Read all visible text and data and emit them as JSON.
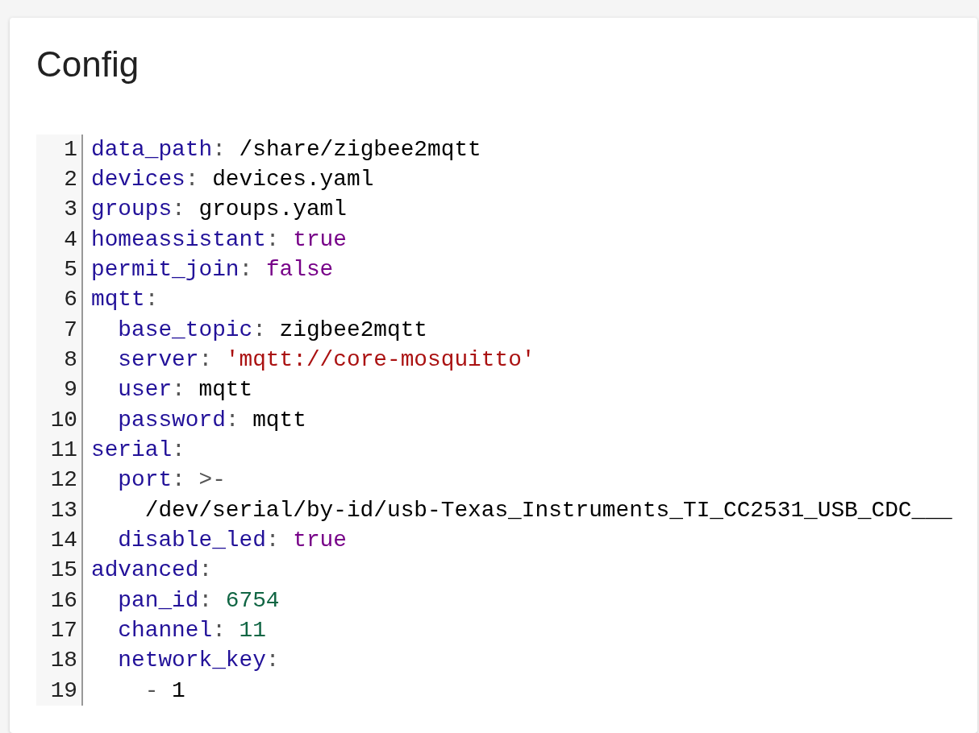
{
  "card": {
    "title": "Config"
  },
  "editor": {
    "lines": [
      {
        "number": "1",
        "key": "data_path",
        "colon": ":",
        "value": "/share/zigbee2mqtt",
        "kind": "plain"
      },
      {
        "number": "2",
        "key": "devices",
        "colon": ":",
        "value": "devices.yaml",
        "kind": "plain"
      },
      {
        "number": "3",
        "key": "groups",
        "colon": ":",
        "value": "groups.yaml",
        "kind": "plain"
      },
      {
        "number": "4",
        "key": "homeassistant",
        "colon": ":",
        "value": "true",
        "kind": "boolean"
      },
      {
        "number": "5",
        "key": "permit_join",
        "colon": ":",
        "value": "false",
        "kind": "boolean"
      },
      {
        "number": "6",
        "key": "mqtt",
        "colon": ":",
        "children": [
          {
            "number": "7",
            "key": "base_topic",
            "colon": ":",
            "value": "zigbee2mqtt",
            "kind": "plain"
          },
          {
            "number": "8",
            "key": "server",
            "colon": ":",
            "value": "'mqtt://core-mosquitto'",
            "kind": "string"
          },
          {
            "number": "9",
            "key": "user",
            "colon": ":",
            "value": "mqtt",
            "kind": "plain"
          },
          {
            "number": "10",
            "key": "password",
            "colon": ":",
            "value": "mqtt",
            "kind": "plain"
          }
        ]
      },
      {
        "number": "11",
        "key": "serial",
        "colon": ":",
        "children": [
          {
            "number": "12",
            "key": "port",
            "colon": ":",
            "value": ">-",
            "kind": "indicator",
            "children": [
              {
                "number": "13",
                "value": "/dev/serial/by-id/usb-Texas_Instruments_TI_CC2531_USB_CDC___",
                "kind": "plain"
              }
            ]
          },
          {
            "number": "14",
            "key": "disable_led",
            "colon": ":",
            "value": "true",
            "kind": "boolean"
          }
        ]
      },
      {
        "number": "15",
        "key": "advanced",
        "colon": ":",
        "children": [
          {
            "number": "16",
            "key": "pan_id",
            "colon": ":",
            "value": "6754",
            "kind": "number"
          },
          {
            "number": "17",
            "key": "channel",
            "colon": ":",
            "value": "11",
            "kind": "number"
          },
          {
            "number": "18",
            "key": "network_key",
            "colon": ":",
            "children": [
              {
                "number": "19",
                "dash": "-",
                "value": "1",
                "kind": "plain"
              }
            ]
          }
        ]
      }
    ]
  }
}
